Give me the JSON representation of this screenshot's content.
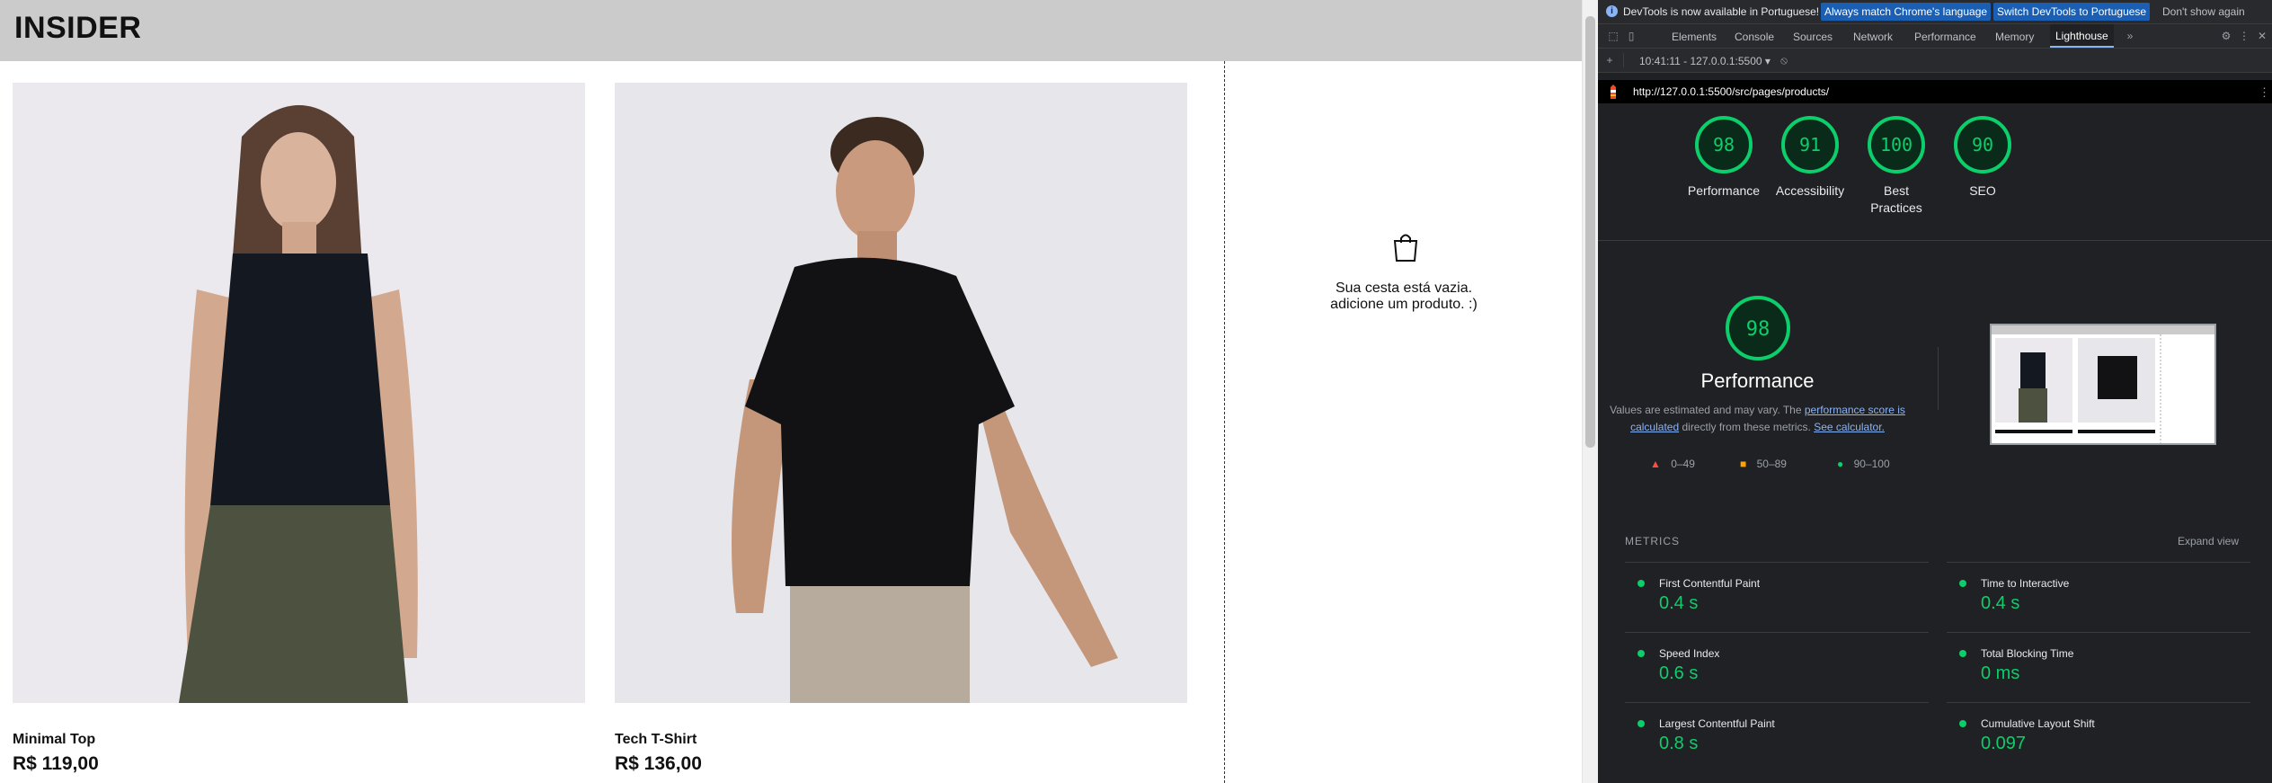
{
  "site": {
    "brand": "INSIDER",
    "products": [
      {
        "name": "Minimal Top",
        "price": "R$ 119,00"
      },
      {
        "name": "Tech T-Shirt",
        "price": "R$ 136,00"
      }
    ],
    "cart": {
      "line1": "Sua cesta está vazia.",
      "line2": "adicione um produto. :)"
    }
  },
  "devtools": {
    "infobar": {
      "text": "DevTools is now available in Portuguese!",
      "btn_match": "Always match Chrome's language",
      "btn_switch": "Switch DevTools to Portuguese",
      "dismiss": "Don't show again"
    },
    "tabs": [
      "Elements",
      "Console",
      "Sources",
      "Network",
      "Performance",
      "Memory",
      "Lighthouse"
    ],
    "active_tab": "Lighthouse",
    "report_select": "10:41:11 - 127.0.0.1:5500",
    "url": "http://127.0.0.1:5500/src/pages/products/",
    "scores": [
      {
        "value": "98",
        "label": "Performance"
      },
      {
        "value": "91",
        "label": "Accessibility"
      },
      {
        "value": "100",
        "label": "Best Practices"
      },
      {
        "value": "90",
        "label": "SEO"
      }
    ],
    "perf": {
      "value": "98",
      "title": "Performance",
      "desc_pre": "Values are estimated and may vary. The ",
      "desc_link1": "performance score is calculated",
      "desc_mid": " directly from these metrics. ",
      "desc_link2": "See calculator."
    },
    "legend": [
      "0–49",
      "50–89",
      "90–100"
    ],
    "metrics_header": "METRICS",
    "expand": "Expand view",
    "metrics": [
      {
        "name": "First Contentful Paint",
        "value": "0.4 s"
      },
      {
        "name": "Time to Interactive",
        "value": "0.4 s"
      },
      {
        "name": "Speed Index",
        "value": "0.6 s"
      },
      {
        "name": "Total Blocking Time",
        "value": "0 ms"
      },
      {
        "name": "Largest Contentful Paint",
        "value": "0.8 s"
      },
      {
        "name": "Cumulative Layout Shift",
        "value": "0.097"
      }
    ],
    "colors": {
      "pass": "#0cce6b",
      "average": "#ffa400",
      "fail": "#ff4e42"
    }
  }
}
